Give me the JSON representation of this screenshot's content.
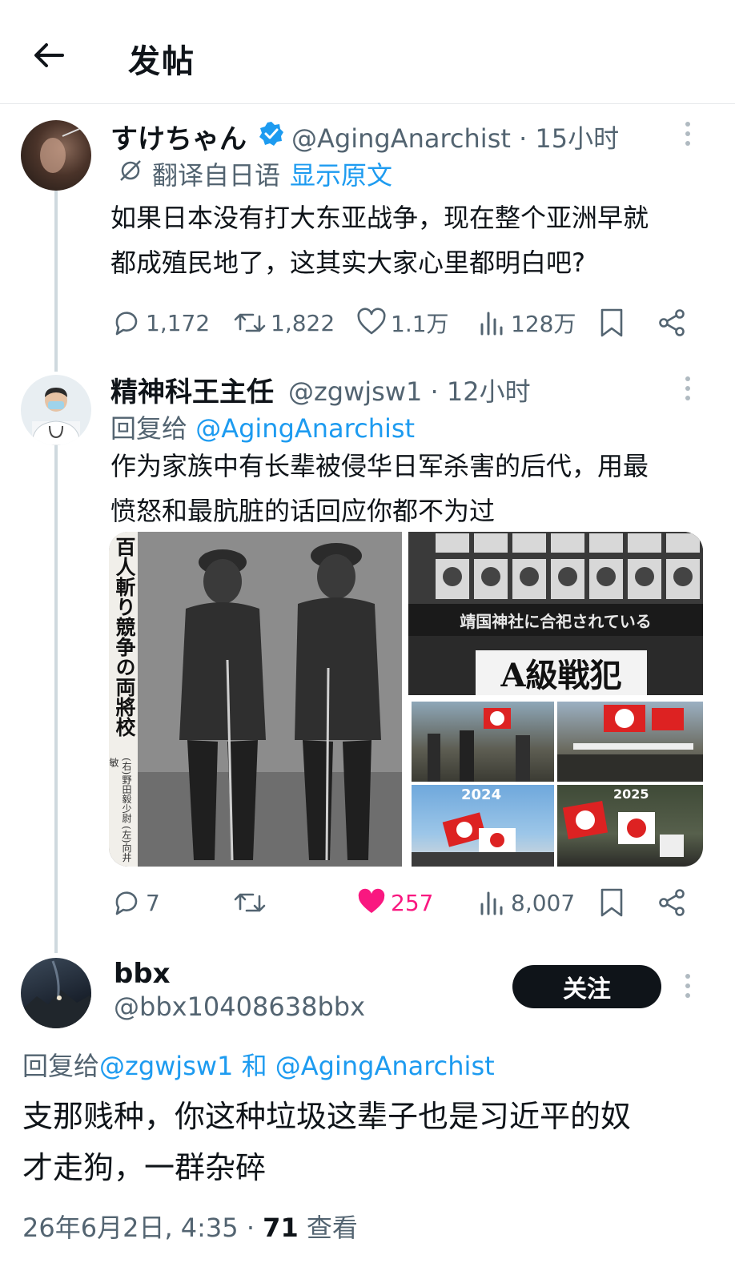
{
  "header": {
    "title": "发帖"
  },
  "tweets": [
    {
      "name": "すけちゃん",
      "handle": "@AgingAnarchist",
      "time": "· 15小时",
      "translate_label": "翻译自日语",
      "show_original": "显示原文",
      "text_lines": [
        "如果日本没有打大东亚战争，现在整个亚洲早就",
        "都成殖民地了，这其实大家心里都明白吧?"
      ],
      "stats": {
        "replies": "1,172",
        "retweets": "1,822",
        "likes": "1.1万",
        "views": "128万"
      }
    },
    {
      "name": "精神科王主任",
      "handle": "@zgwjsw1",
      "time": "· 12小时",
      "reply_prefix": "回复给",
      "reply_to": "@AgingAnarchist",
      "text_lines": [
        "作为家族中有长辈被侵华日军杀害的后代，用最",
        "愤怒和最肮脏的话回应你都不为过"
      ],
      "media": {
        "left_caption": "百人斬り競争の両將校",
        "left_sub": "(右)野田毅少尉 (左)向井敏",
        "top_right_caption": "靖国神社に合祀されている",
        "top_right_banner": "A級戦犯",
        "year_left": "2024",
        "year_right": "2025"
      },
      "stats": {
        "replies": "7",
        "retweets": "",
        "likes": "257",
        "views": "8,007"
      }
    },
    {
      "name": "bbx",
      "handle": "@bbx10408638bbx",
      "follow_label": "关注",
      "reply_prefix": "回复给",
      "reply_to_1": "@zgwjsw1",
      "reply_and": "和",
      "reply_to_2": "@AgingAnarchist",
      "text_lines": [
        "支那贱种，你这种垃圾这辈子也是习近平的奴",
        "才走狗，一群杂碎"
      ],
      "timestamp": "26年6月2日, 4:35",
      "views_count": "71",
      "views_label": "查看"
    }
  ],
  "colors": {
    "accent": "#1d9bf0",
    "like_active": "#f91880",
    "text": "#0f1419",
    "muted": "#536471"
  }
}
